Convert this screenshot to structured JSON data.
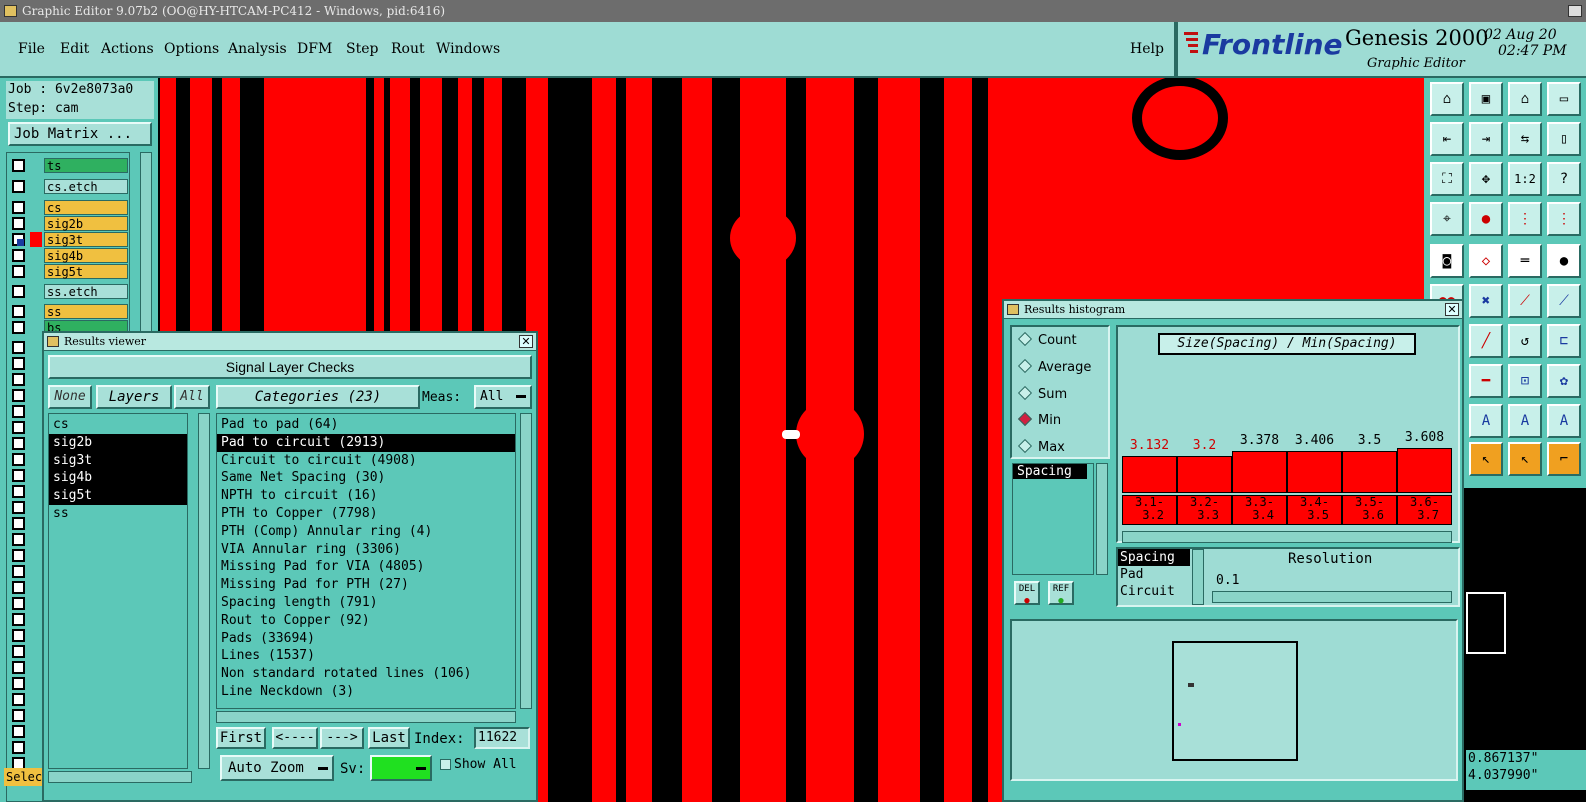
{
  "titlebar": {
    "title": "Graphic Editor 9.07b2 (OO@HY-HTCAM-PC412 - Windows, pid:6416)"
  },
  "menu": {
    "items": [
      "File",
      "Edit",
      "Actions",
      "Options",
      "Analysis",
      "DFM",
      "Step",
      "Rout",
      "Windows"
    ],
    "help": "Help"
  },
  "brand": {
    "logo": "Frontline",
    "product": "Genesis 2000",
    "subtitle": "Graphic Editor",
    "date": "02 Aug 20",
    "time": "02:47 PM"
  },
  "left": {
    "job": "Job : 6v2e8073a0",
    "step": "Step: cam",
    "job_matrix": "Job Matrix ...",
    "layers": [
      {
        "name": "ts",
        "color": "#2fb060"
      },
      {
        "name": "cs.etch",
        "color": "#a8e0d8"
      },
      {
        "name": "cs",
        "color": "#f0c040"
      },
      {
        "name": "sig2b",
        "color": "#f0c040"
      },
      {
        "name": "sig3t",
        "color": "#f0c040"
      },
      {
        "name": "sig4b",
        "color": "#f0c040"
      },
      {
        "name": "sig5t",
        "color": "#f0c040"
      },
      {
        "name": "ss.etch",
        "color": "#a8e0d8"
      },
      {
        "name": "ss",
        "color": "#f0c040"
      },
      {
        "name": "bs",
        "color": "#2fb060"
      }
    ],
    "sel_label": "Selec"
  },
  "results_viewer": {
    "title": "Results viewer",
    "header": "Signal Layer Checks",
    "none_btn": "None",
    "layers_btn": "Layers",
    "all_btn": "All",
    "categories_btn": "Categories (23)",
    "meas_label": "Meas:",
    "meas_value": "All",
    "layers": [
      "cs",
      "sig2b",
      "sig3t",
      "sig4b",
      "sig5t",
      "ss"
    ],
    "selected_layers": [
      1,
      2,
      3,
      4
    ],
    "categories": [
      "Pad to pad (64)",
      "Pad to circuit (2913)",
      "Circuit to circuit (4908)",
      "Same Net Spacing (30)",
      "NPTH to circuit (16)",
      "PTH to Copper (7798)",
      "PTH (Comp) Annular ring (4)",
      "VIA Annular ring (3306)",
      "Missing Pad for VIA (4805)",
      "Missing Pad for PTH (27)",
      "Spacing length (791)",
      "Rout to Copper (92)",
      "Pads (33694)",
      "Lines (1537)",
      "Non standard rotated lines (106)",
      "Line Neckdown (3)"
    ],
    "selected_category": 1,
    "first": "First",
    "prev": "<----",
    "next": "--->",
    "last": "Last",
    "index_label": "Index:",
    "index_value": "11622",
    "zoom": "Auto Zoom",
    "sv": "Sv:",
    "show_all": "Show All"
  },
  "histogram": {
    "title": "Results histogram",
    "radios": [
      "Count",
      "Average",
      "Sum",
      "Min",
      "Max"
    ],
    "selected_radio": 3,
    "list": [
      "Spacing"
    ],
    "chart_title": "Size(Spacing) / Min(Spacing)",
    "del": "DEL",
    "ref": "REF",
    "params": [
      "Spacing",
      "Pad",
      "Circuit"
    ],
    "resolution_label": "Resolution",
    "resolution_value": "0.1"
  },
  "chart_data": {
    "type": "bar",
    "categories": [
      "3.1-3.2",
      "3.2-3.3",
      "3.3-3.4",
      "3.4-3.5",
      "3.5-3.6",
      "3.6-3.7"
    ],
    "values": [
      3.132,
      3.2,
      3.378,
      3.406,
      3.5,
      3.608
    ],
    "value_labels": [
      "3.132",
      "3.2",
      "3.378",
      "3.406",
      "3.5",
      "3.608"
    ],
    "bar_levels": [
      0.78,
      0.78,
      0.87,
      0.87,
      0.87,
      0.93
    ],
    "label_colors": [
      "#d00000",
      "#d00000",
      "#000000",
      "#000000",
      "#000000",
      "#000000"
    ],
    "title": "Size(Spacing) / Min(Spacing)"
  },
  "coords": {
    "x": "0.867137\"",
    "y": "4.037990\""
  }
}
